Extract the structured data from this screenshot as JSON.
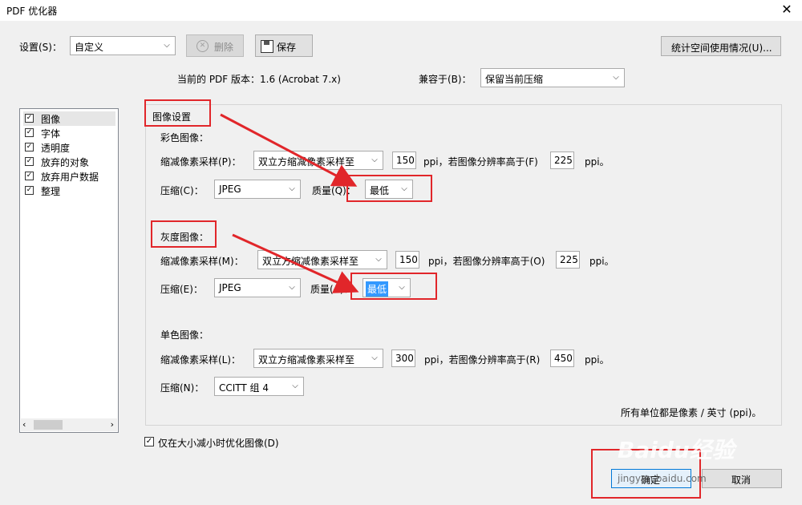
{
  "window": {
    "title": "PDF 优化器"
  },
  "top": {
    "settings_label": "设置(S)：",
    "settings_value": "自定义",
    "delete_label": "删除",
    "save_label": "保存",
    "audit_label": "统计空间使用情况(U)...",
    "version_text": "当前的 PDF 版本：1.6 (Acrobat 7.x)",
    "compat_label": "兼容于(B)：",
    "compat_value": "保留当前压缩"
  },
  "sidebar": {
    "items": [
      {
        "label": "图像"
      },
      {
        "label": "字体"
      },
      {
        "label": "透明度"
      },
      {
        "label": "放弃的对象"
      },
      {
        "label": "放弃用户数据"
      },
      {
        "label": "整理"
      }
    ]
  },
  "image_settings": {
    "title": "图像设置",
    "color": {
      "heading": "彩色图像：",
      "downsample_label": "缩减像素采样(P)：",
      "downsample_value": "双立方缩减像素采样至",
      "ppi_value": "150",
      "ppi_text": "ppi，若图像分辨率高于(F)",
      "above_value": "225",
      "ppi_unit": "ppi。",
      "compress_label": "压缩(C)：",
      "compress_value": "JPEG",
      "quality_label": "质量(Q)：",
      "quality_value": "最低"
    },
    "gray": {
      "heading": "灰度图像：",
      "downsample_label": "缩减像素采样(M)：",
      "downsample_value": "双立方缩减像素采样至",
      "ppi_value": "150",
      "ppi_text": "ppi，若图像分辨率高于(O)",
      "above_value": "225",
      "ppi_unit": "ppi。",
      "compress_label": "压缩(E)：",
      "compress_value": "JPEG",
      "quality_label": "质量(A)：",
      "quality_value": "最低"
    },
    "mono": {
      "heading": "单色图像：",
      "downsample_label": "缩减像素采样(L)：",
      "downsample_value": "双立方缩减像素采样至",
      "ppi_value": "300",
      "ppi_text": "ppi，若图像分辨率高于(R)",
      "above_value": "450",
      "ppi_unit": "ppi。",
      "compress_label": "压缩(N)：",
      "compress_value": "CCITT 组 4"
    },
    "units_note": "所有单位都是像素 / 英寸 (ppi)。"
  },
  "bottom": {
    "optimize_checkbox_label": "仅在大小减小时优化图像(D)",
    "ok_label": "确定",
    "cancel_label": "取消"
  },
  "watermark": {
    "brand": "Baidu经验",
    "url": "jingyan.baidu.com"
  },
  "colors": {
    "annotation_red": "#e1262a",
    "selection_blue": "#3399ff"
  }
}
